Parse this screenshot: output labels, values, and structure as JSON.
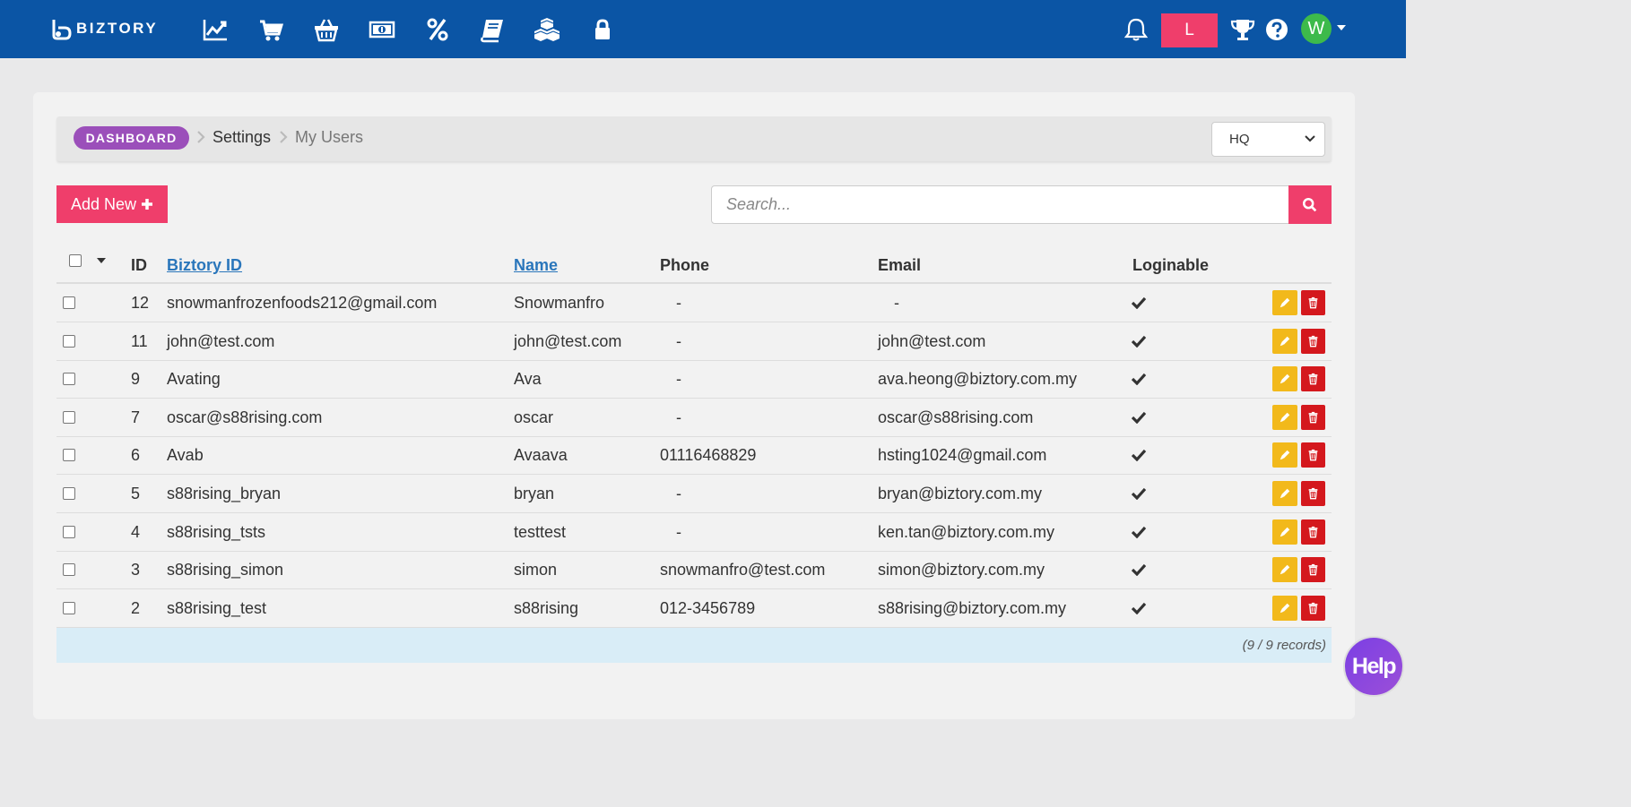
{
  "app": {
    "logo_text": "BIZTORY",
    "user_initial": "L",
    "avatar_initial": "W",
    "colors": {
      "header": "#0b55a5",
      "accent": "#ef3e6b",
      "breadcrumb": "#9b4fba",
      "avatar": "#3dba4b",
      "edit": "#f2b91b",
      "delete": "#d4181d",
      "link": "#2a76bb"
    }
  },
  "nav_icons": [
    "chart-line-icon",
    "cart-icon",
    "basket-icon",
    "money-icon",
    "percent-icon",
    "book-icon",
    "cubes-icon",
    "lock-icon"
  ],
  "right_icons": [
    "bell-icon",
    "trophy-icon",
    "question-icon"
  ],
  "breadcrumb": {
    "dashboard": "DASHBOARD",
    "settings": "Settings",
    "current": "My Users"
  },
  "branch": {
    "selected": "HQ"
  },
  "toolbar": {
    "add_label": "Add New",
    "search_placeholder": "Search..."
  },
  "table": {
    "headers": {
      "id": "ID",
      "biztory_id": "Biztory ID",
      "name": "Name",
      "phone": "Phone",
      "email": "Email",
      "loginable": "Loginable"
    },
    "rows": [
      {
        "id": "12",
        "biztory_id": "snowmanfrozenfoods212@gmail.com",
        "name": "Snowmanfro",
        "phone": "-",
        "email": "-",
        "loginable": true
      },
      {
        "id": "11",
        "biztory_id": "john@test.com",
        "name": "john@test.com",
        "phone": "-",
        "email": "john@test.com",
        "loginable": true
      },
      {
        "id": "9",
        "biztory_id": "Avating",
        "name": "Ava",
        "phone": "-",
        "email": "ava.heong@biztory.com.my",
        "loginable": true
      },
      {
        "id": "7",
        "biztory_id": "oscar@s88rising.com",
        "name": "oscar",
        "phone": "-",
        "email": "oscar@s88rising.com",
        "loginable": true
      },
      {
        "id": "6",
        "biztory_id": "Avab",
        "name": "Avaava",
        "phone": "01116468829",
        "email": "hsting1024@gmail.com",
        "loginable": true
      },
      {
        "id": "5",
        "biztory_id": "s88rising_bryan",
        "name": "bryan",
        "phone": "-",
        "email": "bryan@biztory.com.my",
        "loginable": true
      },
      {
        "id": "4",
        "biztory_id": "s88rising_tsts",
        "name": "testtest",
        "phone": "-",
        "email": "ken.tan@biztory.com.my",
        "loginable": true
      },
      {
        "id": "3",
        "biztory_id": "s88rising_simon",
        "name": "simon",
        "phone": "snowmanfro@test.com",
        "email": "simon@biztory.com.my",
        "loginable": true
      },
      {
        "id": "2",
        "biztory_id": "s88rising_test",
        "name": "s88rising",
        "phone": "012-3456789",
        "email": "s88rising@biztory.com.my",
        "loginable": true
      }
    ],
    "records_text": "(9 / 9 records)"
  },
  "help": {
    "label": "Help"
  }
}
